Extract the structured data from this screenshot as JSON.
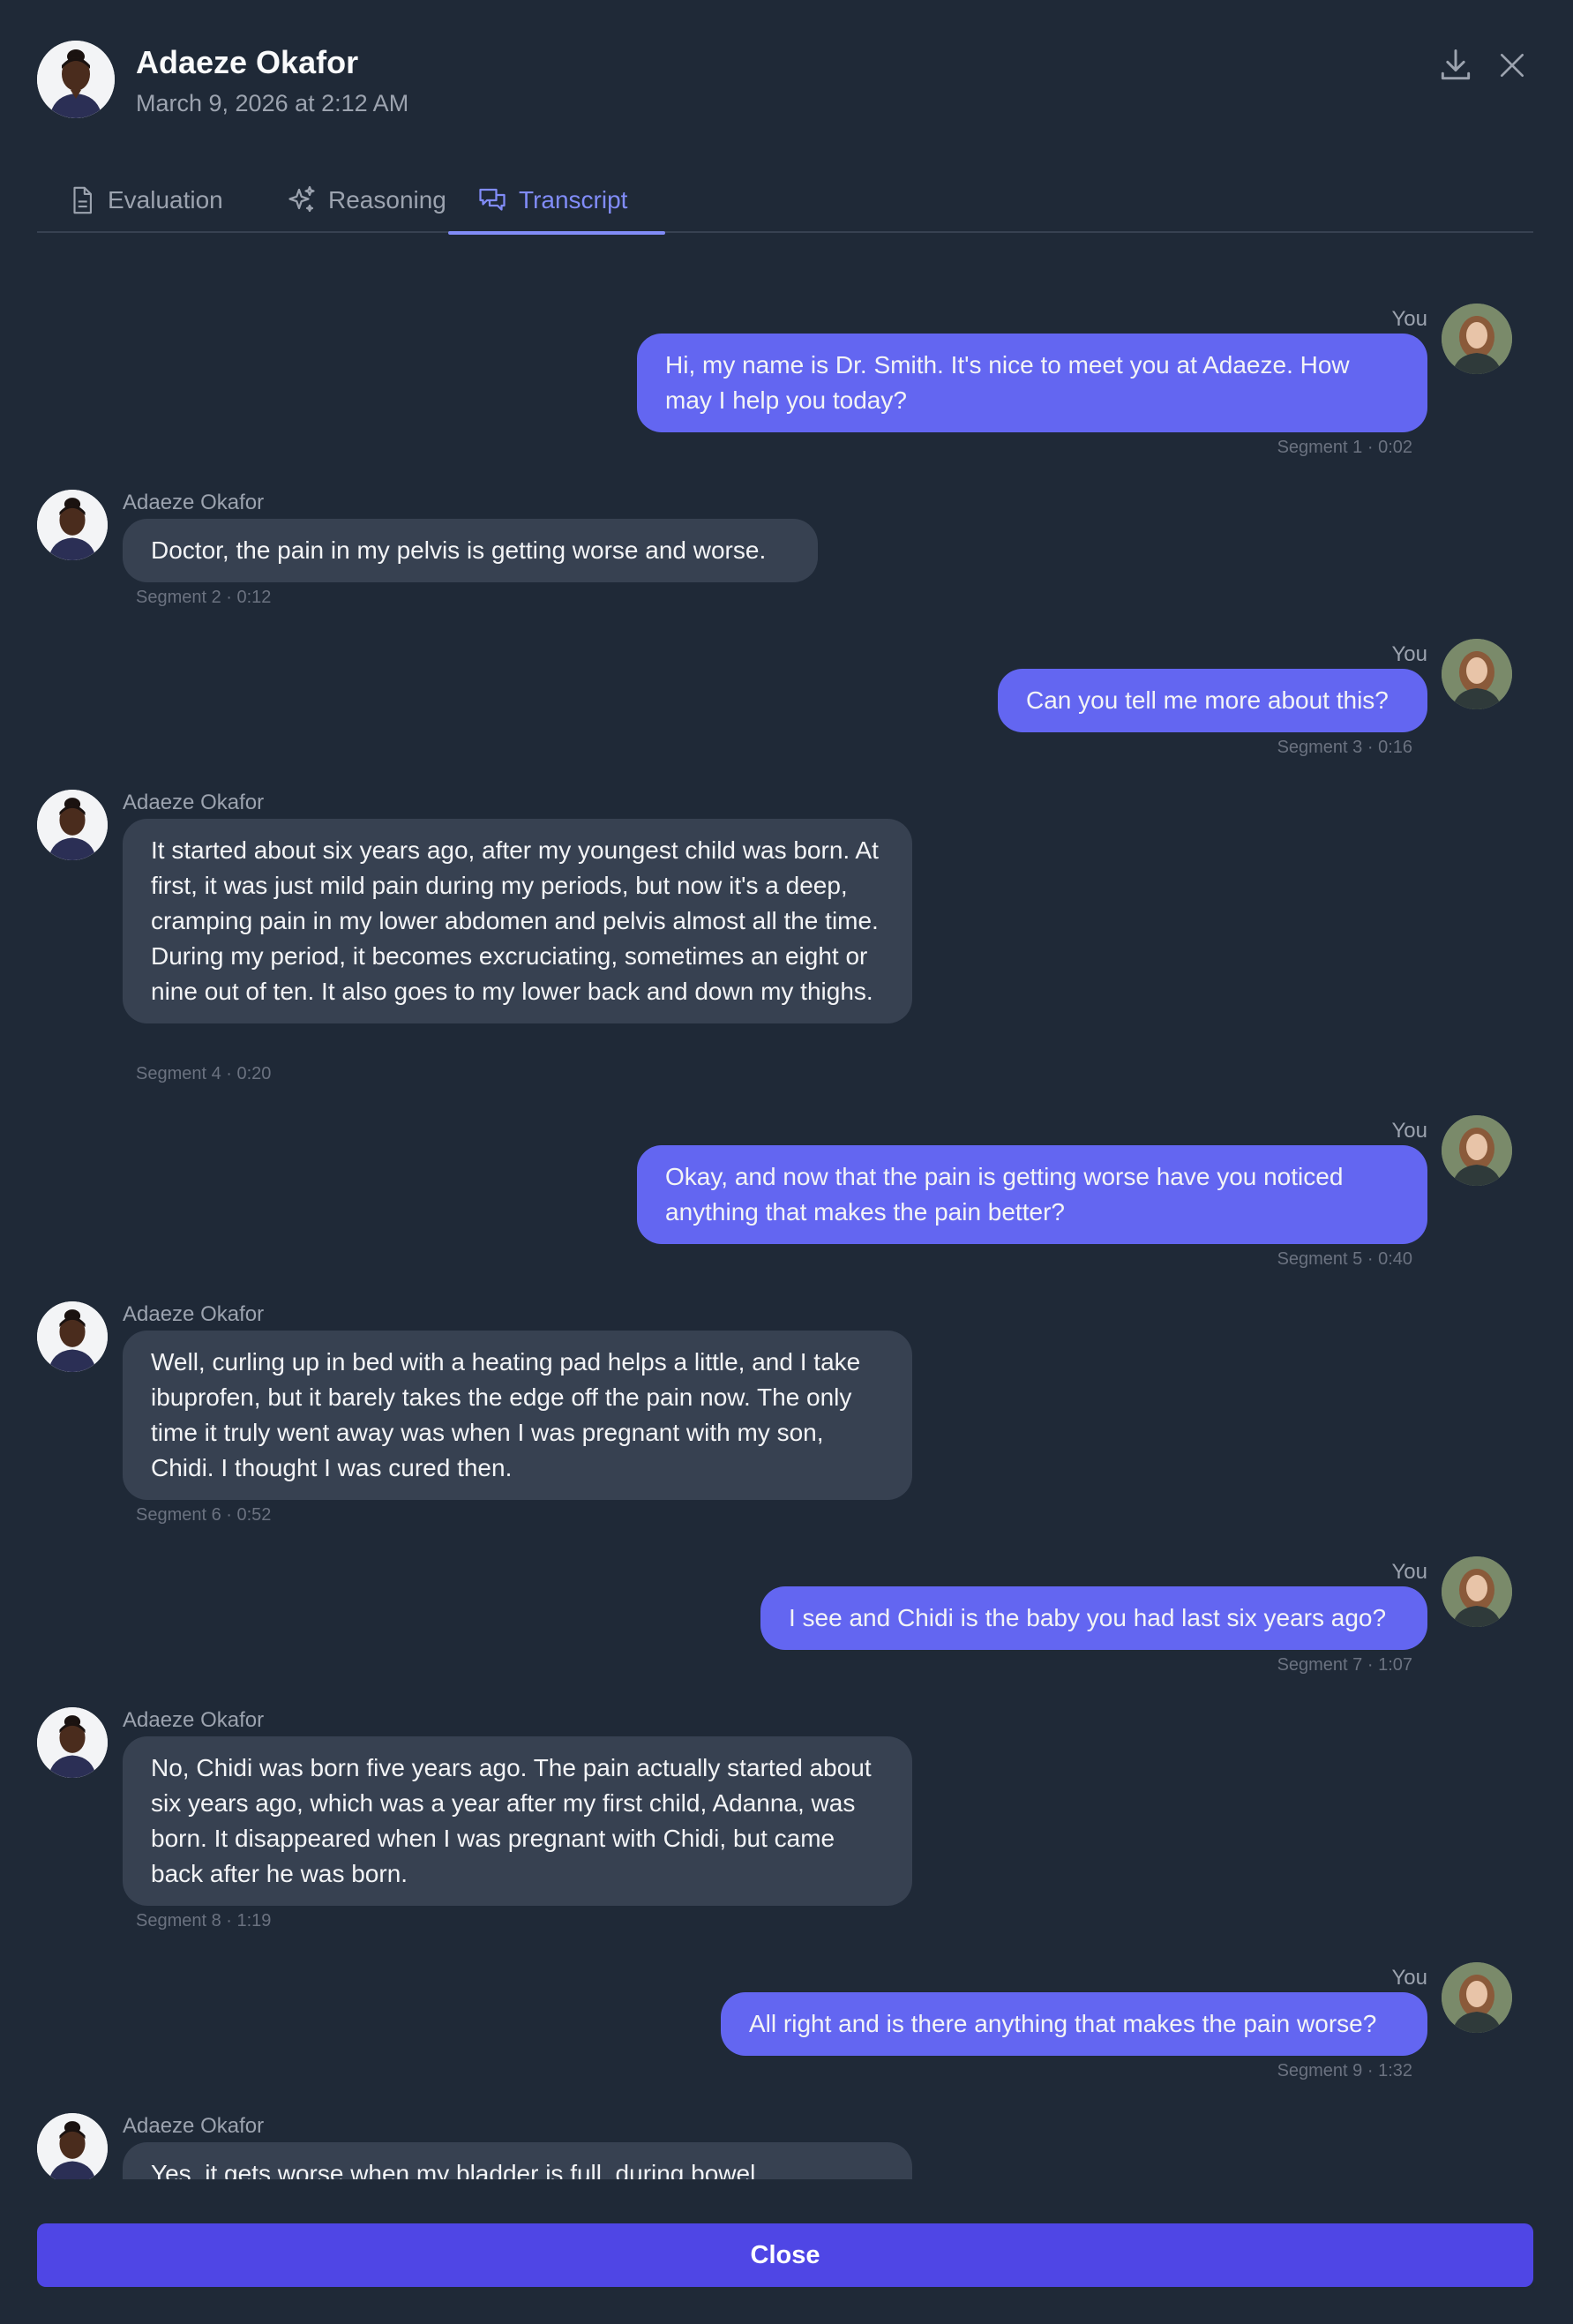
{
  "header": {
    "name": "Adaeze Okafor",
    "timestamp": "March 9, 2026 at 2:12 AM",
    "download_icon": "download-icon",
    "close_icon": "close-icon"
  },
  "tabs": [
    {
      "label": "Evaluation",
      "icon": "document-icon",
      "active": false
    },
    {
      "label": "Reasoning",
      "icon": "sparkles-icon",
      "active": false
    },
    {
      "label": "Transcript",
      "icon": "chat-bubbles-icon",
      "active": true
    }
  ],
  "transcript": {
    "messages": [
      {
        "speaker": "You",
        "text": "Hi, my name is Dr. Smith. It's nice to meet you at Adaeze. How may I help you today?",
        "meta": "Segment 1 · 0:02"
      },
      {
        "speaker": "Adaeze Okafor",
        "text": "Doctor, the pain in my pelvis is getting worse and worse.",
        "meta": "Segment 2 · 0:12"
      },
      {
        "speaker": "You",
        "text": "Can you tell me more about this?",
        "meta": "Segment 3 · 0:16"
      },
      {
        "speaker": "Adaeze Okafor",
        "text": "It started about six years ago, after my youngest child was born. At first, it was just mild pain during my periods, but now it's a deep, cramping pain in my lower abdomen and pelvis almost all the time. During my period, it becomes excruciating, sometimes an eight or nine out of ten. It also goes to my lower back and down my thighs.",
        "meta": "Segment 4 · 0:20"
      },
      {
        "speaker": "You",
        "text": "Okay, and now that the pain is getting worse have you noticed anything that makes the pain better?",
        "meta": "Segment 5 · 0:40"
      },
      {
        "speaker": "Adaeze Okafor",
        "text": "Well, curling up in bed with a heating pad helps a little, and I take ibuprofen, but it barely takes the edge off the pain now. The only time it truly went away was when I was pregnant with my son, Chidi. I thought I was cured then.",
        "meta": "Segment 6 · 0:52"
      },
      {
        "speaker": "You",
        "text": "I see and Chidi is the baby you had last six years ago?",
        "meta": "Segment 7 · 1:07"
      },
      {
        "speaker": "Adaeze Okafor",
        "text": "No, Chidi was born five years ago. The pain actually started about six years ago, which was a year after my first child, Adanna, was born. It disappeared when I was pregnant with Chidi, but came back after he was born.",
        "meta": "Segment 8 · 1:19"
      },
      {
        "speaker": "You",
        "text": "All right and is there anything that makes the pain worse?",
        "meta": "Segment 9 · 1:32"
      },
      {
        "speaker": "Adaeze Okafor",
        "text": "Yes, it gets worse when my bladder is full, during bowel",
        "meta": ""
      }
    ]
  },
  "footer": {
    "close_label": "Close"
  },
  "colors": {
    "background": "#1f2937",
    "accent": "#818cf8",
    "you_bubble": "#6366f1",
    "patient_bubble": "#374151",
    "close_button": "#4f46e5"
  }
}
